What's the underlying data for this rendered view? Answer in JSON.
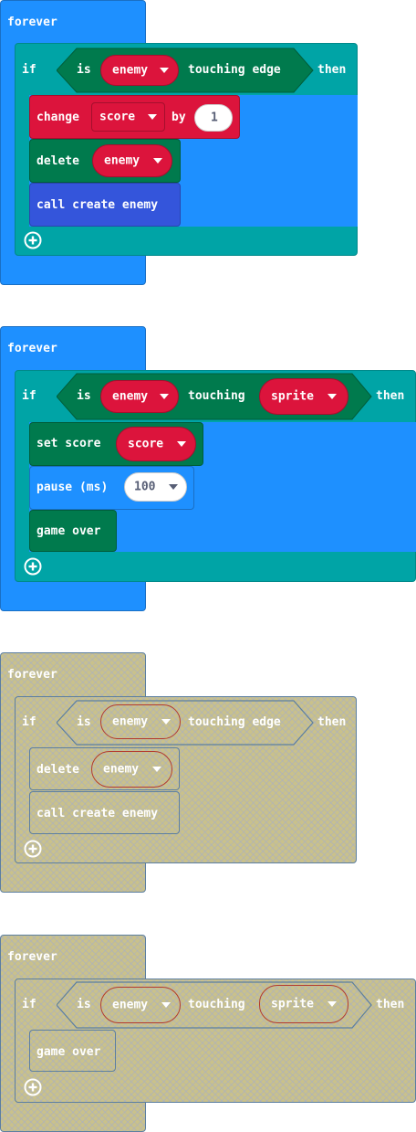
{
  "colors": {
    "loops_blue": "#1e90ff",
    "logic_teal": "#00a4a6",
    "sprite_green": "#007a4d",
    "sprite_var_red": "#dc143c",
    "function_blue": "#3455db",
    "disabled_fill": "#c9c18b"
  },
  "blocks": [
    {
      "label": "forever",
      "if": {
        "label": "if",
        "is": "is",
        "dropdown": "enemy",
        "rel": "touching edge",
        "then": "then"
      },
      "body": [
        {
          "k1": "change",
          "dd": "score",
          "k2": "by",
          "num": "1"
        },
        {
          "k1": "delete",
          "dd": "enemy"
        },
        {
          "k1": "call create enemy"
        }
      ]
    },
    {
      "label": "forever",
      "if": {
        "label": "if",
        "is": "is",
        "dropdown": "enemy",
        "rel": "touching",
        "dropdown2": "sprite",
        "then": "then"
      },
      "body": [
        {
          "k1": "set score",
          "dd": "score"
        },
        {
          "k1": "pause (ms)",
          "dd": "100"
        },
        {
          "k1": "game over"
        }
      ]
    },
    {
      "label": "forever",
      "disabled": true,
      "if": {
        "label": "if",
        "is": "is",
        "dropdown": "enemy",
        "rel": "touching edge",
        "then": "then"
      },
      "body": [
        {
          "k1": "delete",
          "dd": "enemy"
        },
        {
          "k1": "call create enemy"
        }
      ]
    },
    {
      "label": "forever",
      "disabled": true,
      "if": {
        "label": "if",
        "is": "is",
        "dropdown": "enemy",
        "rel": "touching",
        "dropdown2": "sprite",
        "then": "then"
      },
      "body": [
        {
          "k1": "game over"
        }
      ]
    }
  ],
  "icons": {
    "add": "plus-circle-icon",
    "dropdown": "caret-down-icon"
  }
}
